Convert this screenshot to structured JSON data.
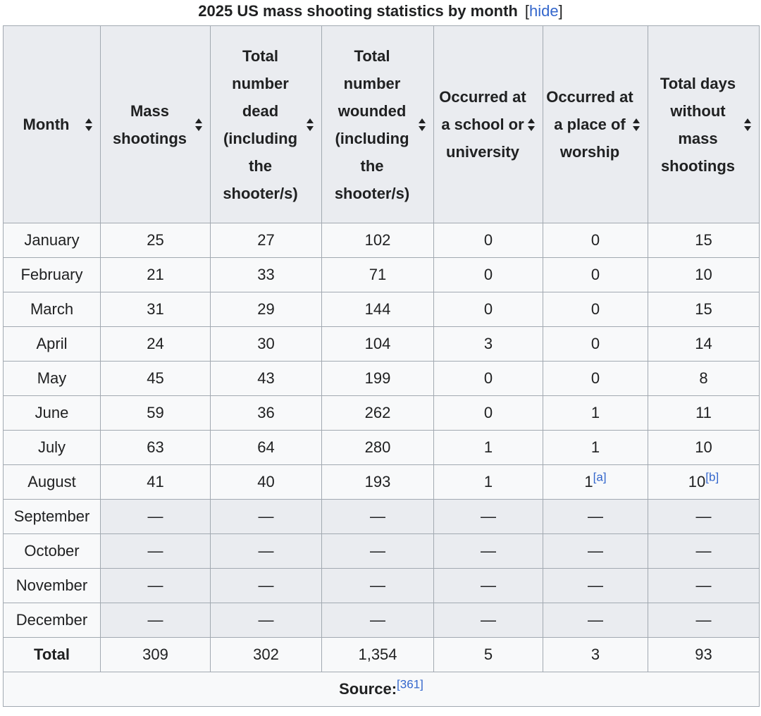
{
  "caption": {
    "title": "2025 US mass shooting statistics by month",
    "hide_open": "[",
    "hide_label": "hide",
    "hide_close": "]"
  },
  "headers": [
    "Month",
    "Mass shootings",
    "Total number dead (including the shooter/s)",
    "Total number wounded (including the shooter/s)",
    "Occurred at a school or university",
    "Occurred at a place of worship",
    "Total days without mass shootings"
  ],
  "rows": [
    {
      "month": "January",
      "shootings": "25",
      "dead": "27",
      "wounded": "102",
      "school": "0",
      "worship": "0",
      "days": "15"
    },
    {
      "month": "February",
      "shootings": "21",
      "dead": "33",
      "wounded": "71",
      "school": "0",
      "worship": "0",
      "days": "10"
    },
    {
      "month": "March",
      "shootings": "31",
      "dead": "29",
      "wounded": "144",
      "school": "0",
      "worship": "0",
      "days": "15"
    },
    {
      "month": "April",
      "shootings": "24",
      "dead": "30",
      "wounded": "104",
      "school": "3",
      "worship": "0",
      "days": "14"
    },
    {
      "month": "May",
      "shootings": "45",
      "dead": "43",
      "wounded": "199",
      "school": "0",
      "worship": "0",
      "days": "8"
    },
    {
      "month": "June",
      "shootings": "59",
      "dead": "36",
      "wounded": "262",
      "school": "0",
      "worship": "1",
      "days": "11"
    },
    {
      "month": "July",
      "shootings": "63",
      "dead": "64",
      "wounded": "280",
      "school": "1",
      "worship": "1",
      "days": "10"
    },
    {
      "month": "August",
      "shootings": "41",
      "dead": "40",
      "wounded": "193",
      "school": "1",
      "worship": "1",
      "worship_note": "[a]",
      "days": "10",
      "days_note": "[b]"
    },
    {
      "month": "September",
      "shootings": "—",
      "dead": "—",
      "wounded": "—",
      "school": "—",
      "worship": "—",
      "days": "—"
    },
    {
      "month": "October",
      "shootings": "—",
      "dead": "—",
      "wounded": "—",
      "school": "—",
      "worship": "—",
      "days": "—"
    },
    {
      "month": "November",
      "shootings": "—",
      "dead": "—",
      "wounded": "—",
      "school": "—",
      "worship": "—",
      "days": "—"
    },
    {
      "month": "December",
      "shootings": "—",
      "dead": "—",
      "wounded": "—",
      "school": "—",
      "worship": "—",
      "days": "—"
    }
  ],
  "total": {
    "label": "Total",
    "shootings": "309",
    "dead": "302",
    "wounded": "1,354",
    "school": "5",
    "worship": "3",
    "days": "93"
  },
  "source": {
    "label": "Source:",
    "ref": "[361]"
  },
  "colors": {
    "header_bg": "#eaecf0",
    "cell_bg": "#f8f9fa",
    "border": "#a2a9b1",
    "link": "#3366cc",
    "text": "#202122"
  }
}
